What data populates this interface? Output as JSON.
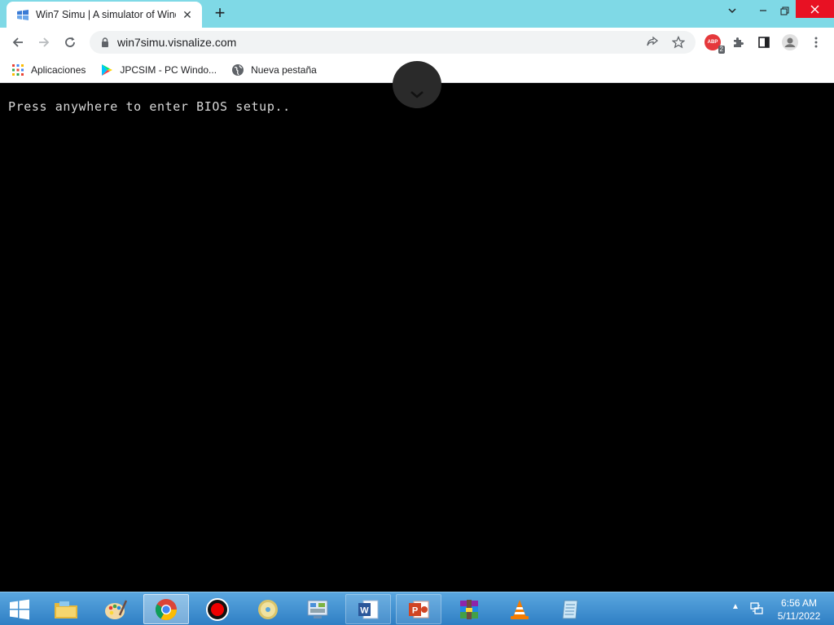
{
  "browser": {
    "tab": {
      "title": "Win7 Simu | A simulator of Wind",
      "favicon": "windows-simulator-icon"
    },
    "url": "win7simu.visnalize.com",
    "extension_badge": "ABP",
    "extension_count": "2",
    "bookmarks": [
      {
        "label": "Aplicaciones",
        "icon": "apps-grid-icon"
      },
      {
        "label": "JPCSIM - PC Windo...",
        "icon": "play-store-icon"
      },
      {
        "label": "Nueva pestaña",
        "icon": "globe-icon"
      }
    ]
  },
  "page": {
    "bios_message": "Press anywhere to enter BIOS setup.."
  },
  "taskbar": {
    "apps": [
      {
        "name": "file-explorer"
      },
      {
        "name": "paint"
      },
      {
        "name": "chrome",
        "state": "active"
      },
      {
        "name": "screen-recorder"
      },
      {
        "name": "dvd-player"
      },
      {
        "name": "control-panel"
      },
      {
        "name": "word",
        "state": "open"
      },
      {
        "name": "powerpoint",
        "state": "open"
      },
      {
        "name": "winrar"
      },
      {
        "name": "vlc"
      },
      {
        "name": "notepad"
      }
    ],
    "time": "6:56 AM",
    "date": "5/11/2022"
  },
  "colors": {
    "titlebar": "#7fd9e6",
    "close_red": "#e81123",
    "taskbar": "#3a8bd0",
    "bios_text": "#d8d8d8"
  }
}
